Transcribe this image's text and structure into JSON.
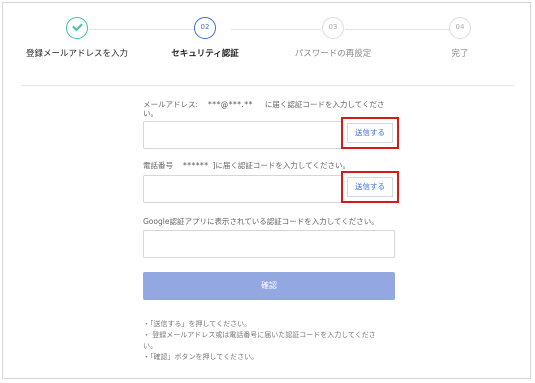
{
  "steps": [
    {
      "number": "",
      "label": "登録メールアドレスを入力",
      "state": "done"
    },
    {
      "number": "02",
      "label": "セキュリティ認証",
      "state": "active"
    },
    {
      "number": "03",
      "label": "パスワードの再設定",
      "state": "pending"
    },
    {
      "number": "04",
      "label": "完了",
      "state": "pending"
    }
  ],
  "form": {
    "email_label_prefix": "メールアドレス:",
    "email_masked": "***@***.**",
    "email_label_suffix": "に届く認証コードを入力してくださ",
    "email_label_wrap": "い。",
    "email_send_label": "送信する",
    "phone_label_prefix": "電話番号",
    "phone_masked": "******",
    "phone_label_suffix": "]に届く認証コードを入力してください。",
    "phone_send_label": "送信する",
    "google_label": "Google認証アプリに表示されている認証コードを入力してください。",
    "confirm_label": "確認"
  },
  "notes": [
    "・「送信する」を押してください。",
    "・ 登録メールアドレス或は電話番号に届いた認証コードを入力してくださ",
    "い。",
    "・「確認」ボタンを押してください。"
  ],
  "colors": {
    "done": "#3fc1a5",
    "active": "#3a6fd8",
    "confirm_button": "#93a7e0",
    "highlight_border": "#d51a1a"
  }
}
